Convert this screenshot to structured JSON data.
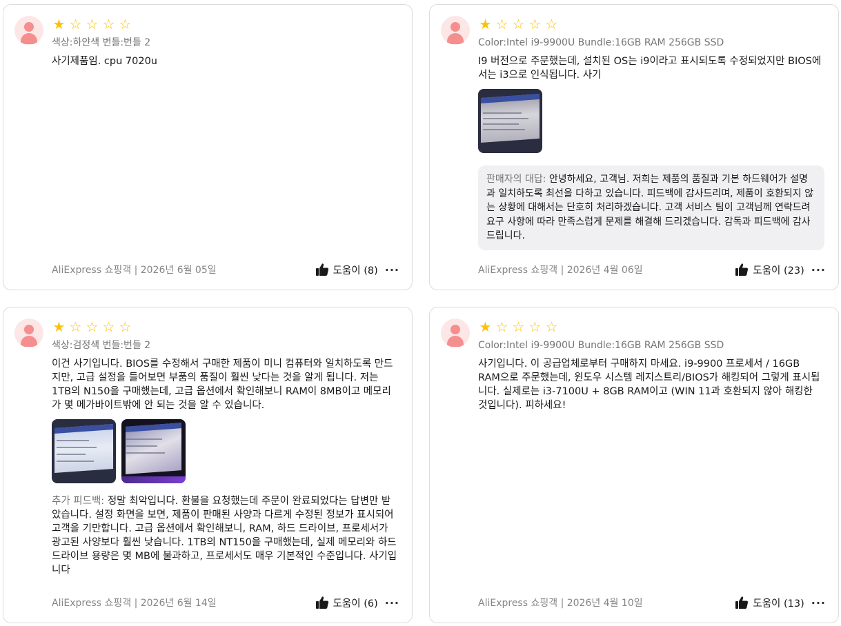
{
  "reviews": [
    {
      "rating": 1,
      "sku": "색상:하얀색 번들:번들 2",
      "text": "사기제품임. cpu 7020u",
      "photos": [],
      "meta": "AliExpress 쇼핑객 | 2026년 6월 05일",
      "helpful": "도움이 (8)"
    },
    {
      "rating": 1,
      "sku": "Color:Intel i9-9900U Bundle:16GB RAM 256GB SSD",
      "text": "I9 버전으로 주문했는데, 설치된 OS는 i9이라고 표시되도록 수정되었지만 BIOS에서는 i3으로 인식됩니다. 사기",
      "photos": [
        "bios-photo"
      ],
      "reply_label": "판매자의 대답: ",
      "reply_text": "안녕하세요, 고객님. 저희는 제품의 품질과 기본 하드웨어가 설명과 일치하도록 최선을 다하고 있습니다. 피드백에 감사드리며, 제품이 호환되지 않는 상황에 대해서는 단호히 처리하겠습니다. 고객 서비스 팀이 고객님께 연락드려 요구 사항에 따라 만족스럽게 문제를 해결해 드리겠습니다. 감독과 피드백에 감사드립니다.",
      "meta": "AliExpress 쇼핑객 | 2026년 4월 06일",
      "helpful": "도움이 (23)"
    },
    {
      "rating": 1,
      "sku": "색상:검정색 번들:번들 2",
      "text": "이건 사기입니다. BIOS를 수정해서 구매한 제품이 미니 컴퓨터와 일치하도록 만드지만, 고급 설정을 들어보면 부품의 품질이 훨씬 낮다는 것을 알게 됩니다. 저는 1TB의 N150을 구매했는데, 고급 옵션에서 확인해보니 RAM이 8MB이고 메모리가 몇 메가바이트밖에 안 되는 것을 알 수 있습니다.",
      "photos": [
        "bios-photo-1",
        "bios-photo-2"
      ],
      "extra_label": "추가 피드백: ",
      "extra_text": "정말 최악입니다. 환불을 요청했는데 주문이 완료되었다는 답변만 받았습니다. 설정 화면을 보면, 제품이 판매된 사양과 다르게 수정된 정보가 표시되어 고객을 기만합니다. 고급 옵션에서 확인해보니, RAM, 하드 드라이브, 프로세서가 광고된 사양보다 훨씬 낮습니다. 1TB의 NT150을 구매했는데, 실제 메모리와 하드 드라이브 용량은 몇 MB에 불과하고, 프로세서도 매우 기본적인 수준입니다. 사기입니다",
      "meta": "AliExpress 쇼핑객 | 2026년 6월 14일",
      "helpful": "도움이 (6)"
    },
    {
      "rating": 1,
      "sku": "Color:Intel i9-9900U Bundle:16GB RAM 256GB SSD",
      "text": "사기입니다. 이 공급업체로부터 구매하지 마세요. i9-9900 프로세서 / 16GB RAM으로 주문했는데, 윈도우 시스템 레지스트리/BIOS가 해킹되어 그렇게 표시됩니다. 실제로는 i3-7100U + 8GB RAM이고 (WIN 11과 호환되지 않아 해킹한 것입니다). 피하세요!",
      "photos": [],
      "meta": "AliExpress 쇼핑객 | 2026년 4월 10일",
      "helpful": "도움이 (13)"
    }
  ],
  "icons": {
    "star_filled": "★",
    "star_empty": "☆",
    "more": "···",
    "thumb": "thumbs-up-icon"
  },
  "colors": {
    "star": "#ffc107",
    "avatar_bg": "#fde6e6",
    "avatar_fg": "#f58f8f",
    "reply_bg": "#f0f0f2"
  }
}
